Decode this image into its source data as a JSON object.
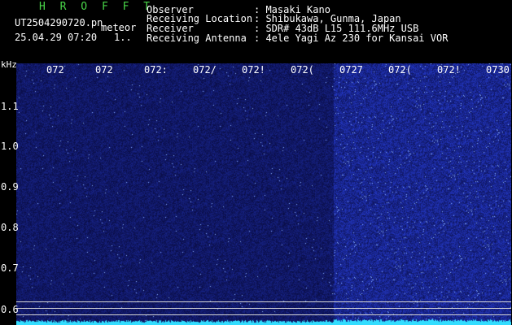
{
  "header": {
    "app_logo": "H R O F F T",
    "file_name": "UT2504290720.pn",
    "meteor_label": "meteor",
    "date_time": "25.04.29 07:20",
    "count_label": "1.."
  },
  "info": {
    "rows": [
      {
        "label": "Observer",
        "value": ": Masaki Kano"
      },
      {
        "label": "Receiving Location",
        "value": ": Shibukawa, Gunma, Japan"
      },
      {
        "label": "Receiver",
        "value": ": SDR# 43dB L15 111.6MHz USB"
      },
      {
        "label": "Receiving Antenna",
        "value": ": 4ele Yagi Az 230 for Kansai VOR"
      }
    ]
  },
  "axis": {
    "unit": "kHz",
    "time_ticks": [
      "072",
      "072",
      "072:",
      "072/",
      "072!",
      "072(",
      "0727",
      "072(",
      "072!",
      "0730"
    ],
    "freq_ticks": [
      "1.1",
      "1.0",
      "0.9",
      "0.8",
      "0.7",
      "0.6"
    ]
  },
  "colors": {
    "background": "#000000",
    "logo": "#49d649",
    "text": "#ffffff",
    "baseline": "#33ddff",
    "noise_low": "#101070",
    "noise_high": "#2c3cc8"
  }
}
